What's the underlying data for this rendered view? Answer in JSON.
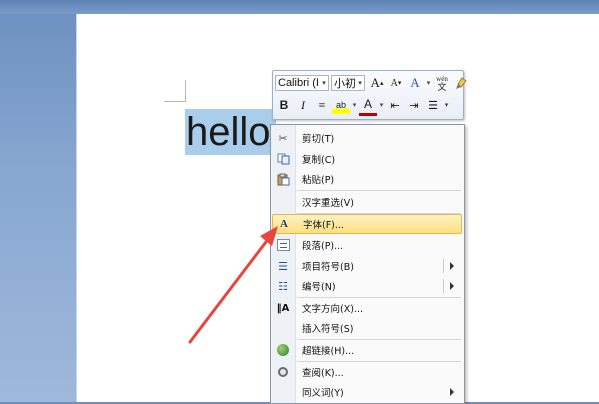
{
  "document": {
    "selected_text": "hello"
  },
  "mini_toolbar": {
    "font_name": "Calibri (I",
    "font_size": "小初",
    "grow_font_glyph": "A",
    "shrink_font_glyph": "A",
    "styles_glyph": "A",
    "format_painter_glyph": "wén",
    "bold_glyph": "B",
    "italic_glyph": "I",
    "center_glyph": "≡",
    "highlight_glyph": "ab",
    "font_color_glyph": "A",
    "decrease_indent_glyph": "⇤",
    "increase_indent_glyph": "⇥",
    "bullets_glyph": "☰",
    "dropdown_glyph": "▾",
    "highlight_color": "#ffff00",
    "font_color": "#c00000"
  },
  "context_menu": {
    "items": [
      {
        "label": "剪切(T)",
        "icon": "scissors-icon"
      },
      {
        "label": "复制(C)",
        "icon": "copy-icon"
      },
      {
        "label": "粘贴(P)",
        "icon": "paste-icon"
      },
      {
        "label": "汉字重选(V)",
        "icon": ""
      },
      {
        "label": "字体(F)...",
        "icon": "font-icon",
        "highlighted": true
      },
      {
        "label": "段落(P)...",
        "icon": "paragraph-icon"
      },
      {
        "label": "项目符号(B)",
        "icon": "bullets-icon",
        "submenu": true
      },
      {
        "label": "编号(N)",
        "icon": "numbering-icon",
        "submenu": true
      },
      {
        "label": "文字方向(X)...",
        "icon": "text-direction-icon"
      },
      {
        "label": "插入符号(S)",
        "icon": ""
      },
      {
        "label": "超链接(H)...",
        "icon": "hyperlink-icon"
      },
      {
        "label": "查阅(K)...",
        "icon": "lookup-icon"
      },
      {
        "label": "同义词(Y)",
        "icon": "",
        "submenu": true
      }
    ]
  },
  "annotation": {
    "arrow_color": "#e8453c"
  }
}
